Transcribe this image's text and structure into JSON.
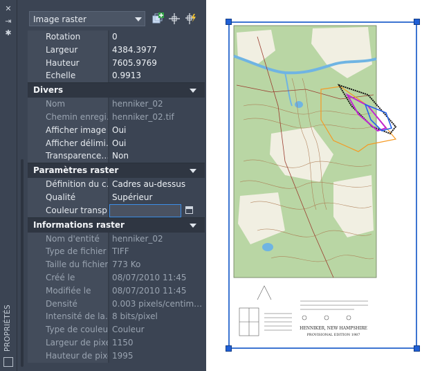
{
  "strip": {
    "label": "PROPRIÉTÉS"
  },
  "toolbar": {
    "object_type": "Image raster"
  },
  "sections": {
    "divers": "Divers",
    "parametres": "Paramètres raster",
    "informations": "Informations raster"
  },
  "geometry": [
    {
      "k": "Rotation",
      "v": "0"
    },
    {
      "k": "Largeur",
      "v": "4384.3977"
    },
    {
      "k": "Hauteur",
      "v": "7605.9769"
    },
    {
      "k": "Echelle",
      "v": "0.9913"
    }
  ],
  "divers": [
    {
      "k": "Nom",
      "v": "henniker_02"
    },
    {
      "k": "Chemin enregi…",
      "v": "henniker_02.tif"
    },
    {
      "k": "Afficher image",
      "v": "Oui"
    },
    {
      "k": "Afficher délimi…",
      "v": "Oui"
    },
    {
      "k": "Transparence…",
      "v": "Non"
    }
  ],
  "parametres": [
    {
      "k": "Définition du c…",
      "v": "Cadres au-dessus"
    },
    {
      "k": "Qualité",
      "v": "Supérieur"
    },
    {
      "k": "Couleur transp…",
      "v": ""
    }
  ],
  "informations": [
    {
      "k": "Nom d'entité",
      "v": "henniker_02"
    },
    {
      "k": "Type de fichier",
      "v": "TIFF"
    },
    {
      "k": "Taille du fichier",
      "v": "773 Ko"
    },
    {
      "k": "Créé le",
      "v": "08/07/2010 11:45"
    },
    {
      "k": "Modifiée le",
      "v": "08/07/2010 11:45"
    },
    {
      "k": "Densité",
      "v": "0.003  pixels/centim…"
    },
    {
      "k": "Intensité de la…",
      "v": "8 bits/pixel"
    },
    {
      "k": "Type de couleur",
      "v": "Couleur"
    },
    {
      "k": "Largeur de pixel",
      "v": "1150"
    },
    {
      "k": "Hauteur de pixel",
      "v": "1995"
    }
  ],
  "map": {
    "place_title": "HENNIKER, NEW HAMPSHIRE",
    "edition": "PROVISIONAL EDITION 1987",
    "colors": {
      "forest": "#b9d6a4",
      "clearing": "#f1efe2",
      "water": "#6fb4e3",
      "contour": "#a9744a",
      "selection": "#3c74d1"
    }
  }
}
